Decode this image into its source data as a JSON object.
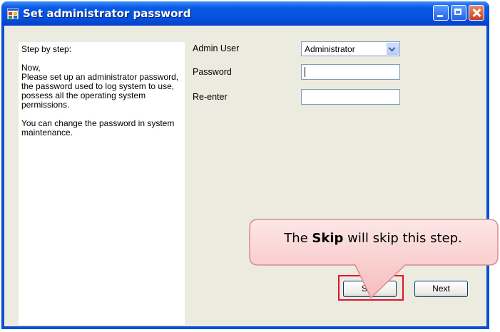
{
  "window": {
    "title": "Set administrator password"
  },
  "info": {
    "line1": "Step by step:",
    "line2": "Now,\nPlease set up an administrator password, the password used to log system to use, possess all the operating system permissions.",
    "line3": "You can change the password in system maintenance."
  },
  "form": {
    "admin_user_label": "Admin User",
    "admin_user_value": "Administrator",
    "password_label": "Password",
    "reenter_label": "Re-enter"
  },
  "buttons": {
    "skip_label": "Skip",
    "next_label": "Next"
  },
  "callout": {
    "prefix": "The ",
    "bold": "Skip",
    "suffix": " will skip this step."
  },
  "colors": {
    "titlebar": "#0550dd",
    "highlight": "#e3142b",
    "callout_fill": "#fbd0d0"
  },
  "icons": [
    "app-icon",
    "minimize-icon",
    "maximize-icon",
    "close-icon",
    "dropdown-arrow-icon"
  ]
}
